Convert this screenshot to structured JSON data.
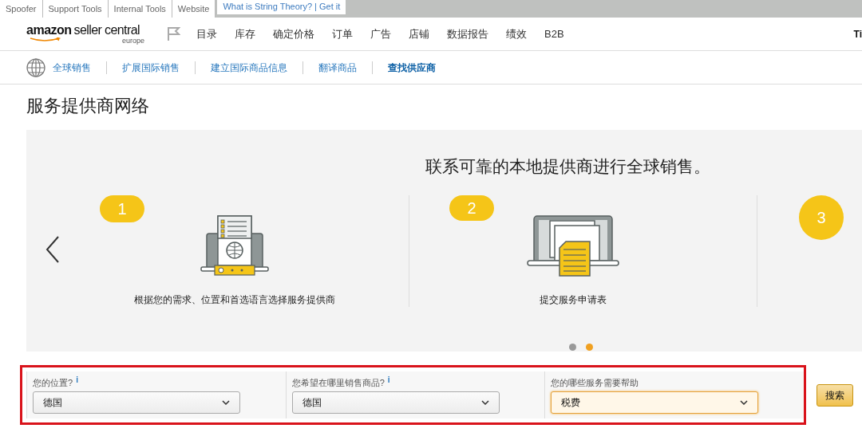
{
  "browser_tabs": [
    {
      "label": "Spoofer"
    },
    {
      "label": "Support Tools"
    },
    {
      "label": "Internal Tools"
    },
    {
      "label": "Website"
    }
  ],
  "banner": "What is String Theory? | Get it",
  "header": {
    "logo_brand": "amazon",
    "logo_product": "seller central",
    "logo_region": "europe",
    "nav": [
      "目录",
      "库存",
      "确定价格",
      "订单",
      "广告",
      "店铺",
      "数据报告",
      "绩效",
      "B2B"
    ],
    "user": "Ti"
  },
  "subnav": [
    {
      "label": "全球销售",
      "selected": false
    },
    {
      "label": "扩展国际销售",
      "selected": false
    },
    {
      "label": "建立国际商品信息",
      "selected": false
    },
    {
      "label": "翻译商品",
      "selected": false
    },
    {
      "label": "查找供应商",
      "selected": true
    }
  ],
  "page_title": "服务提供商网络",
  "carousel": {
    "heading": "联系可靠的本地提供商进行全球销售。",
    "steps": [
      {
        "number": "1",
        "kind": "checklist",
        "caption": "根据您的需求、位置和首选语言选择服务提供商"
      },
      {
        "number": "2",
        "kind": "document",
        "caption": "提交服务申请表"
      },
      {
        "number": "3",
        "kind": "none"
      }
    ],
    "dots": [
      {
        "selected": false
      },
      {
        "selected": true
      }
    ]
  },
  "form": {
    "fields": [
      {
        "label": "您的位置?",
        "info": "i",
        "value": "德国",
        "focused": false
      },
      {
        "label": "您希望在哪里销售商品?",
        "info": "i",
        "value": "德国",
        "focused": false
      },
      {
        "label": "您的哪些服务需要帮助",
        "value": "税费",
        "focused": true
      }
    ],
    "search_button": "搜索"
  }
}
